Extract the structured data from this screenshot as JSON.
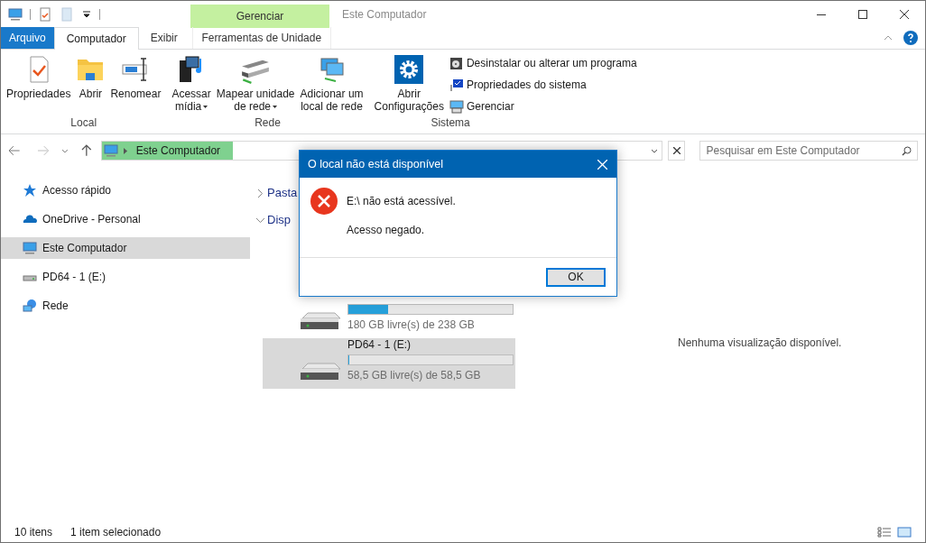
{
  "window": {
    "title": "Este Computador"
  },
  "contextual_tab": {
    "label": "Gerenciar"
  },
  "tabs": [
    {
      "label": "Arquivo",
      "kind": "file",
      "selected": false
    },
    {
      "label": "Computador",
      "kind": "tab",
      "selected": true
    },
    {
      "label": "Exibir",
      "kind": "tab",
      "selected": false
    },
    {
      "label": "Ferramentas de Unidade",
      "kind": "contextual",
      "selected": false
    }
  ],
  "ribbon": {
    "groups": [
      {
        "label": "Local",
        "buttons": [
          {
            "kind": "properties",
            "lines": [
              "Propriedades"
            ],
            "dropdown": false
          },
          {
            "kind": "open",
            "lines": [
              "Abrir"
            ],
            "dropdown": false
          },
          {
            "kind": "rename",
            "lines": [
              "Renomear"
            ],
            "dropdown": false
          }
        ]
      },
      {
        "label": "Rede",
        "buttons": [
          {
            "kind": "media",
            "lines": [
              "Acessar",
              "mídia"
            ],
            "dropdown": true
          },
          {
            "kind": "mapdrive",
            "lines": [
              "Mapear unidade",
              "de rede"
            ],
            "dropdown": true
          },
          {
            "kind": "addlocation",
            "lines": [
              "Adicionar um",
              "local de rede"
            ],
            "dropdown": false
          }
        ]
      },
      {
        "label": "Sistema",
        "buttons": [
          {
            "kind": "settings",
            "lines": [
              "Abrir",
              "Configurações"
            ],
            "dropdown": false
          }
        ],
        "small_buttons": [
          {
            "kind": "uninstall",
            "label": "Desinstalar ou alterar um programa"
          },
          {
            "kind": "sysprops",
            "label": "Propriedades do sistema"
          },
          {
            "kind": "manage",
            "label": "Gerenciar"
          }
        ]
      }
    ]
  },
  "address": {
    "path": "Este Computador"
  },
  "search": {
    "placeholder": "Pesquisar em Este Computador"
  },
  "navigation": [
    {
      "label": "Acesso rápido",
      "kind": "star",
      "selected": false
    },
    {
      "label": "OneDrive - Personal",
      "kind": "cloud",
      "selected": false
    },
    {
      "label": "Este Computador",
      "kind": "pc",
      "selected": true
    },
    {
      "label": "PD64 - 1 (E:)",
      "kind": "drive",
      "selected": false
    },
    {
      "label": "Rede",
      "kind": "network",
      "selected": false
    }
  ],
  "sections": [
    {
      "label": "Pasta",
      "expanded": false
    },
    {
      "label": "Disp",
      "expanded": true
    }
  ],
  "drives": [
    {
      "free": "180 GB livre(s) de 238 GB",
      "level": 0.24,
      "selected": false
    },
    {
      "name": "PD64 - 1 (E:)",
      "free": "58,5 GB livre(s) de 58,5 GB",
      "level": 0,
      "selected": true
    }
  ],
  "preview": {
    "message": "Nenhuma visualização disponível."
  },
  "dialog": {
    "title": "O local não está disponível",
    "message": "E:\\ não está acessível.",
    "detail": "Acesso negado.",
    "button": "OK"
  },
  "status_bar": {
    "count": "10 itens",
    "selection": "1 item selecionado"
  }
}
